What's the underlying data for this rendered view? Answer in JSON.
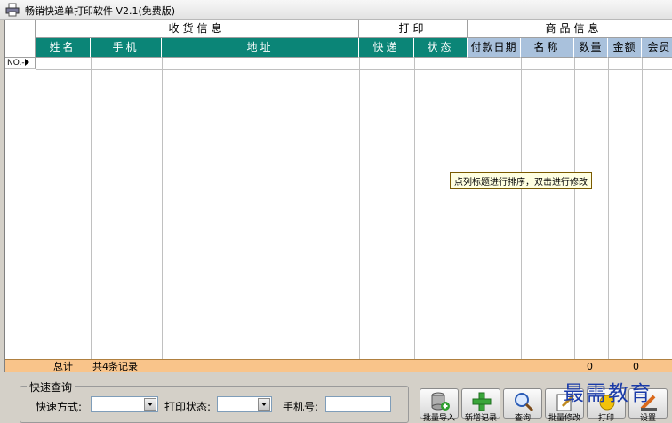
{
  "window": {
    "title": "畅销快递单打印软件 V2.1(免费版)"
  },
  "grid": {
    "groups": [
      "收货信息",
      "打印",
      "商品信息"
    ],
    "columns": [
      "姓名",
      "手机",
      "地址",
      "快递",
      "状态",
      "付款日期",
      "名称",
      "数量",
      "金额",
      "会员"
    ],
    "row_marker": "NO.-",
    "tooltip": "点列标题进行排序，双击进行修改",
    "totals": {
      "label": "总计",
      "count": "共4条记录",
      "qty": "0",
      "amount": "0"
    }
  },
  "quick_search": {
    "title": "快速查询",
    "express_label": "快速方式:",
    "print_status_label": "打印状态:",
    "phone_label": "手机号:"
  },
  "toolbar": {
    "import_label": "批量导入",
    "add_label": "新增记录",
    "search_label": "查询",
    "edit_label": "批量修改",
    "print_label": "打印",
    "settings_label": "设置"
  },
  "watermark": "最需教育",
  "icons": [
    "app-printer-icon",
    "database-add-icon",
    "plus-icon",
    "magnifier-icon",
    "edit-icon",
    "print-icon",
    "settings-icon",
    "dropdown-arrow-icon"
  ],
  "colors": {
    "teal_header": "#0b8577",
    "blue_header": "#a9c1dc",
    "total_bar": "#f9c48a",
    "tooltip_bg": "#ffffe1"
  }
}
